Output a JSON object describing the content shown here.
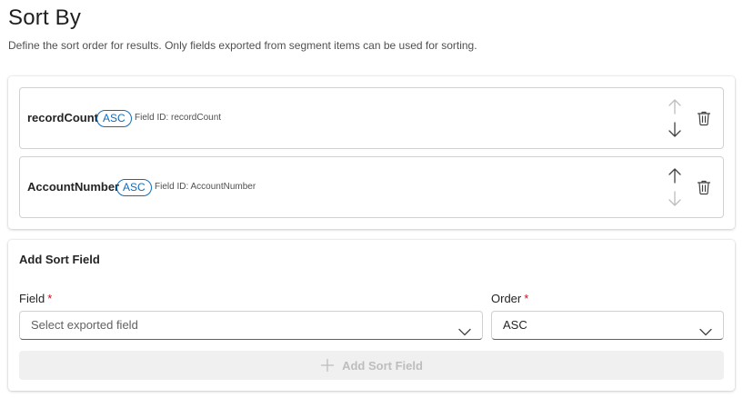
{
  "header": {
    "title": "Sort By",
    "description": "Define the sort order for results. Only fields exported from segment items can be used for sorting."
  },
  "sort_items": [
    {
      "name": "recordCount",
      "order": "ASC",
      "field_id": "Field ID: recordCount",
      "move_up_enabled": false,
      "move_down_enabled": true
    },
    {
      "name": "AccountNumber",
      "order": "ASC",
      "field_id": "Field ID: AccountNumber",
      "move_up_enabled": true,
      "move_down_enabled": false
    }
  ],
  "add_form": {
    "title": "Add Sort Field",
    "field_label": "Field",
    "field_placeholder": "Select exported field",
    "order_label": "Order",
    "order_value": "ASC",
    "required_mark": "*",
    "add_button_label": "Add Sort Field",
    "add_button_enabled": false
  },
  "icons": {
    "move_up": "arrow-up-icon",
    "move_down": "arrow-down-icon",
    "delete": "trash-icon",
    "dropdown": "chevron-down-icon",
    "add": "plus-icon"
  },
  "colors": {
    "accent": "#0f6cbd",
    "required": "#c50f1f",
    "icon_enabled": "#424242",
    "icon_disabled": "#bdbdbd",
    "disabled_button_bg": "#f0f0f0"
  }
}
